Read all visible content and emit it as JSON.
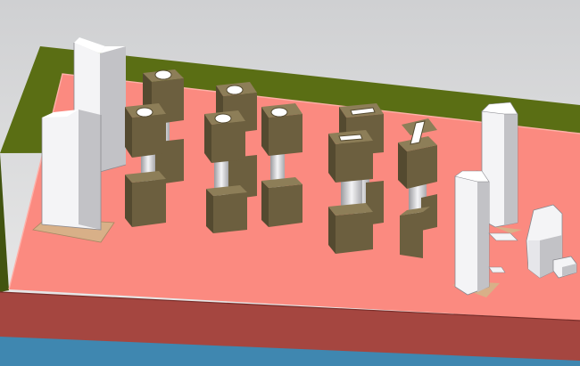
{
  "viewport": {
    "background_top": "#cfd0d2",
    "background_bottom": "#ececec"
  },
  "colors": {
    "board_top": "#fb8a80",
    "board_front": "#a54640",
    "board_right": "#c75a50",
    "frame_olive": "#5a6e14",
    "frame_olive_dark": "#425410",
    "base_blue": "#3f87b0",
    "block_front": "#6c5f3f",
    "block_top": "#8d7e58",
    "block_side": "#544a30",
    "tower_front": "#f4f4f6",
    "tower_side": "#c2c2c6",
    "tower_top": "#ffffff",
    "pad": "#d8b088",
    "slot_white": "#ffffff"
  },
  "components": {
    "tall_towers": 5,
    "stacked_block_pairs": 8,
    "small_parts": 2
  }
}
